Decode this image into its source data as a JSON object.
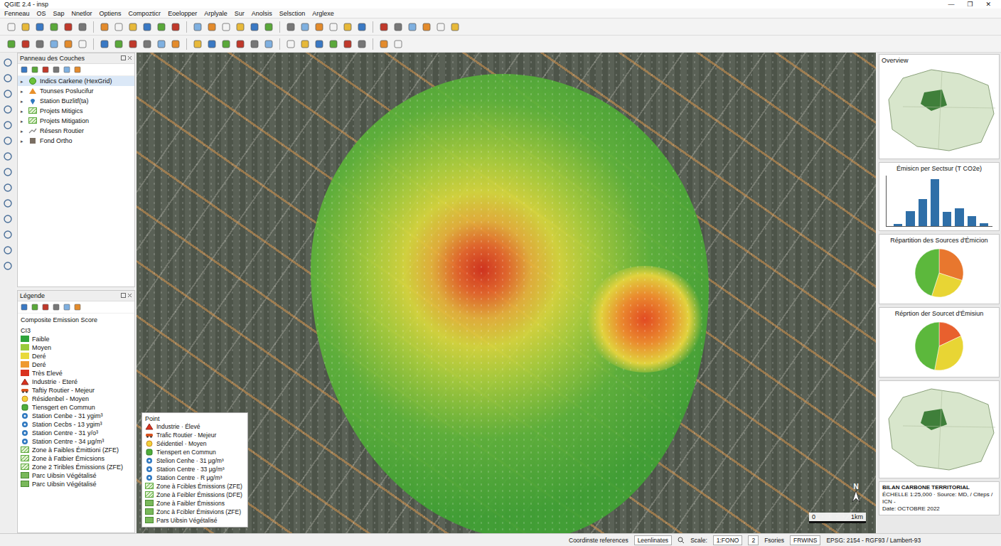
{
  "window": {
    "title": "QGIE 2.4 - insp",
    "controls": [
      "—",
      "❐",
      "✕"
    ]
  },
  "menu": [
    "Fenneau",
    "OS",
    "Sap",
    "Nnetlor",
    "Optiens",
    "Compozticr",
    "Eoelopper",
    "Arplyale",
    "Sur",
    "Anolsis",
    "Selsction",
    "Arglexe"
  ],
  "layers_panel": {
    "title": "Panneau des Couches",
    "layers": [
      {
        "label": "Indics Carkene (HexGrid)",
        "selected": true,
        "kind": "dot"
      },
      {
        "label": "Tounses Poslucifur",
        "selected": false,
        "kind": "triangle"
      },
      {
        "label": "Station Buzlitf(ta)",
        "selected": false,
        "kind": "pin"
      },
      {
        "label": "Projets Mitigics",
        "selected": false,
        "kind": "hatch"
      },
      {
        "label": "Projets Mitigation",
        "selected": false,
        "kind": "hatch"
      },
      {
        "label": "Résesn Routier",
        "selected": false,
        "kind": "line"
      },
      {
        "label": "Fond Ortho",
        "selected": false,
        "kind": "square"
      }
    ]
  },
  "legend_panel": {
    "title": "Légende",
    "heading": "Composite Emission Score",
    "subheading": "CI3",
    "items": [
      {
        "label": "Faible",
        "kind": "ramp",
        "color": "#2fa43a"
      },
      {
        "label": "Moyen",
        "kind": "ramp",
        "color": "#9acb3c"
      },
      {
        "label": "Deré",
        "kind": "ramp",
        "color": "#e8d93b"
      },
      {
        "label": "Deré",
        "kind": "ramp",
        "color": "#ee9a30"
      },
      {
        "label": "Très Elevé",
        "kind": "ramp",
        "color": "#d9321f"
      },
      {
        "label": "Industrie · Eteré",
        "kind": "industry"
      },
      {
        "label": "Taftiy Routier - Mejeur",
        "kind": "traffic"
      },
      {
        "label": "Résidenbel - Moyen",
        "kind": "residential"
      },
      {
        "label": "Tiensgert en Commun",
        "kind": "transit"
      },
      {
        "label": "Station Cenbe - 31 ygim³",
        "kind": "station"
      },
      {
        "label": "Station Cecbs - 13 ygim³",
        "kind": "station"
      },
      {
        "label": "Station Centre - 31 y/o³",
        "kind": "station"
      },
      {
        "label": "Station Centre - 34 μg/m³",
        "kind": "station"
      },
      {
        "label": "Zone à Faibles Émittioni (ZFE)",
        "kind": "hatch"
      },
      {
        "label": "Zone à Fatbier Émicsions",
        "kind": "hatch"
      },
      {
        "label": "Zone 2 Tiribles Émissions (ZFE)",
        "kind": "hatch"
      },
      {
        "label": "Parc Uibsin Végétalisé",
        "kind": "park"
      },
      {
        "label": "Parc Uibsin Végétalisé",
        "kind": "park"
      }
    ]
  },
  "map": {
    "north": "N",
    "scale_start": "0",
    "scale_end": "1km",
    "overlay_legend": {
      "title": "Point",
      "items": [
        {
          "label": "Industrie · Élevé",
          "kind": "industry"
        },
        {
          "label": "Trafic Routier · Mejeur",
          "kind": "traffic"
        },
        {
          "label": "Séidentiel · Moyen",
          "kind": "residential"
        },
        {
          "label": "Tienspert en Commun",
          "kind": "transit"
        },
        {
          "label": "Stelion Cenhe · 31 μg/m³",
          "kind": "station"
        },
        {
          "label": "Station Centre · 33 μg/m³",
          "kind": "station"
        },
        {
          "label": "Station Centre · R μg/m³",
          "kind": "station"
        },
        {
          "label": "Zone à Fcibles Émissions (ZFE)",
          "kind": "hatch"
        },
        {
          "label": "Zone à Feibler Émissions (DFE)",
          "kind": "hatch"
        },
        {
          "label": "Zone à Faibler Émissions",
          "kind": "park"
        },
        {
          "label": "Zonc à Fcibler Émisvions (ZFE)",
          "kind": "park"
        },
        {
          "label": "Pars Uibsin Végétalisé",
          "kind": "park"
        }
      ]
    }
  },
  "overview": {
    "title": "Overview"
  },
  "sector_chart": {
    "title": "Émisicn per Sectsur (T CO2e)",
    "values": [
      4,
      27,
      50,
      86,
      26,
      32,
      18,
      5
    ]
  },
  "pies": [
    {
      "title": "Répartition des Sources d'Émicion",
      "slices": [
        {
          "value": 30,
          "color": "#e8772e"
        },
        {
          "value": 25,
          "color": "#e8d534"
        },
        {
          "value": 45,
          "color": "#5cb83c"
        }
      ]
    },
    {
      "title": "Réprtion der Sourcet d'Émisiun",
      "slices": [
        {
          "value": 18,
          "color": "#e8602e"
        },
        {
          "value": 35,
          "color": "#e8d534"
        },
        {
          "value": 47,
          "color": "#5cb83c"
        }
      ]
    }
  ],
  "footer": {
    "lines": [
      "BILAN CARBONE TERRITORIAL",
      "ÉCHELLE 1:25,000 · Source: MD, / Citeps / ICN -",
      "Date: OCTOBRE 2022"
    ]
  },
  "status_bar": {
    "coord_label": "Coordinste references",
    "coord_value": "Leenlinates",
    "scale_label": "Scale:",
    "scale_value": "1:FONO",
    "rotation": "2",
    "render_label": "Fsories",
    "render_value": "FRWINS",
    "crs": "EPSG: 2154 - RGF93 / Lambert-93"
  }
}
